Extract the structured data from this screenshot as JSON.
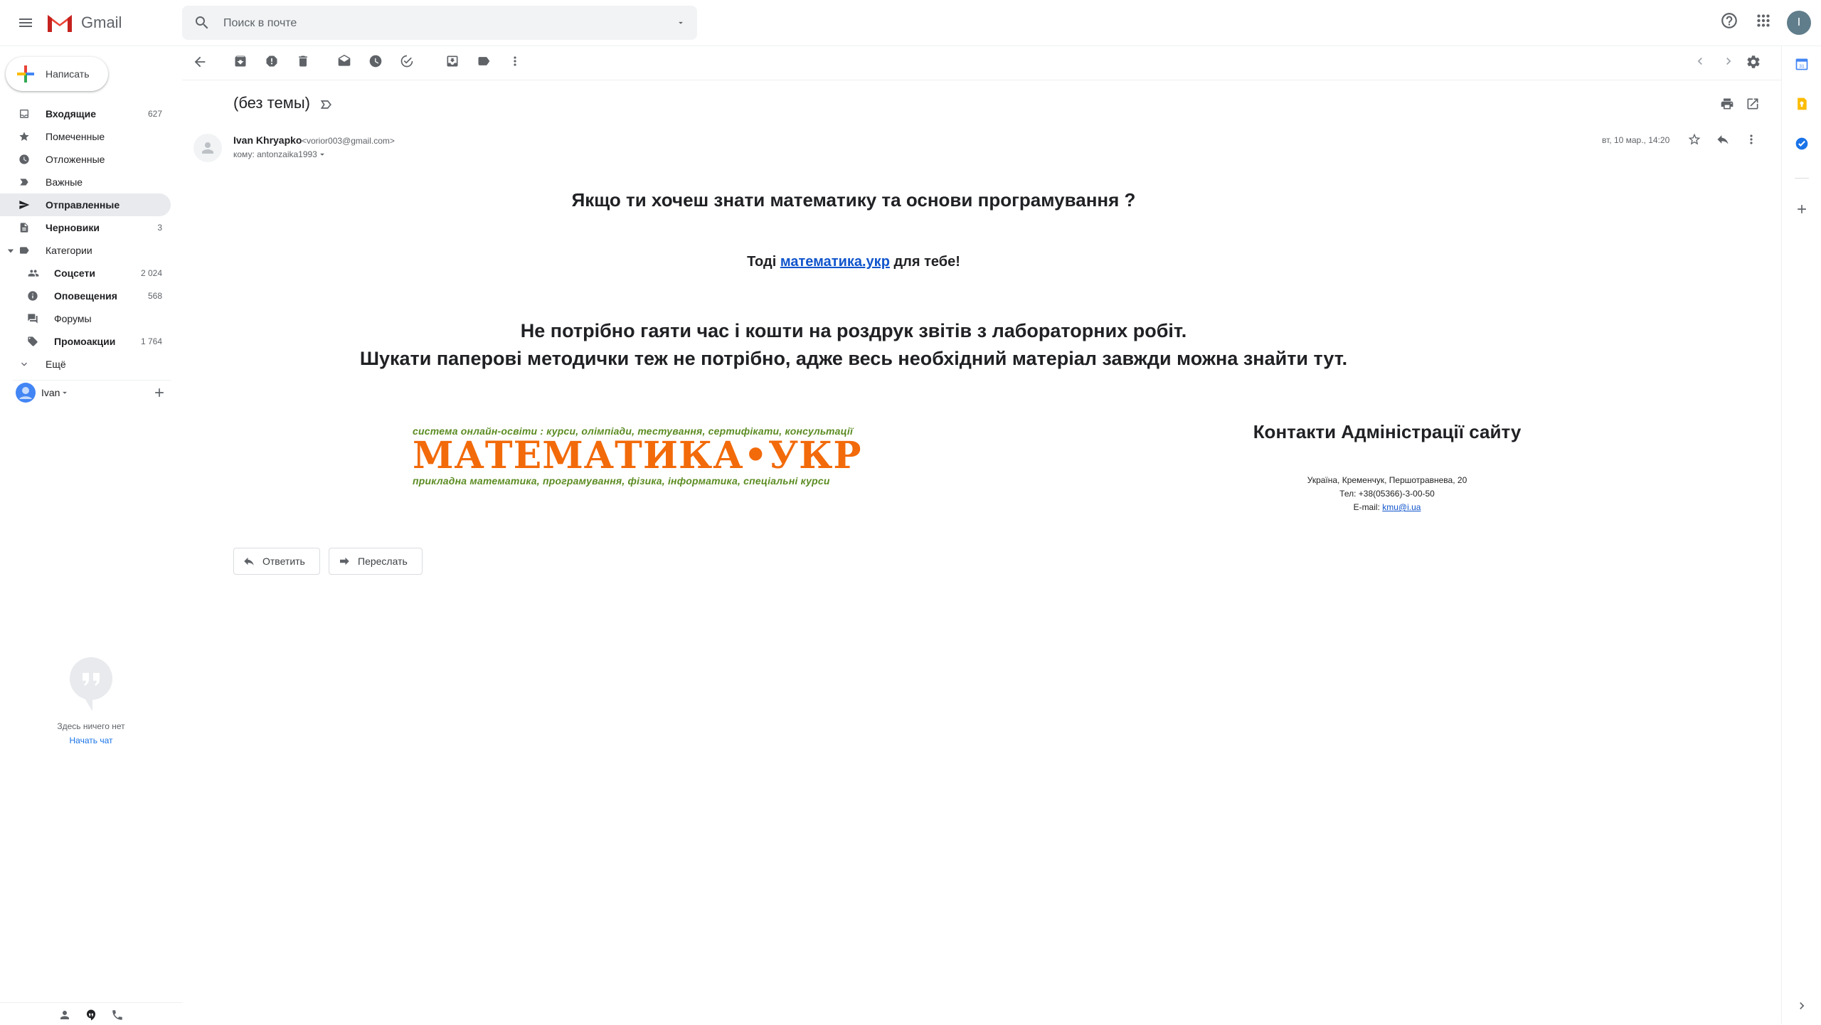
{
  "app": {
    "name": "Gmail"
  },
  "search": {
    "placeholder": "Поиск в почте"
  },
  "account": {
    "initial": "I"
  },
  "compose": {
    "label": "Написать"
  },
  "sidebar": {
    "items": [
      {
        "label": "Входящие",
        "count": "627"
      },
      {
        "label": "Помеченные",
        "count": ""
      },
      {
        "label": "Отложенные",
        "count": ""
      },
      {
        "label": "Важные",
        "count": ""
      },
      {
        "label": "Отправленные",
        "count": ""
      },
      {
        "label": "Черновики",
        "count": "3"
      },
      {
        "label": "Категории",
        "count": ""
      },
      {
        "label": "Соцсети",
        "count": "2 024"
      },
      {
        "label": "Оповещения",
        "count": "568"
      },
      {
        "label": "Форумы",
        "count": ""
      },
      {
        "label": "Промоакции",
        "count": "1 764"
      },
      {
        "label": "Ещё",
        "count": ""
      }
    ],
    "hangouts_user": "Ivan",
    "chat_empty": "Здесь ничего нет",
    "chat_start": "Начать чат"
  },
  "message": {
    "subject": "(без темы)",
    "sender_name": "Ivan Khryapko",
    "sender_email": "<vorior003@gmail.com>",
    "recipient": "кому: antonzaika1993",
    "date": "вт, 10 мар., 14:20",
    "body": {
      "line1": "Якщо ти хочеш знати математику та основи програмування ?",
      "line2_pre": "Тоді ",
      "line2_link": "математика.укр",
      "line2_post": " для тебе!",
      "line3": "Не потрібно гаяти час і кошти на роздрук звітів з лабораторних робіт.",
      "line4": "Шукати паперові методички теж не потрібно, адже весь необхідний матеріал завжди можна знайти тут."
    },
    "logo": {
      "top_text": "система онлайн-освіти : курси, олімпіади, тестування, сертифікати, консультації",
      "main_text": "МАТЕМАТИКА•УКР",
      "bottom_text": "прикладна математика, програмування, фізика, інформатика, спеціальні курси"
    },
    "contacts": {
      "title": "Контакти Адміністрації сайту",
      "address": "Україна, Кременчук, Першотравнева, 20",
      "phone": "Тел: +38(05366)-3-00-50",
      "email_label": "E-mail: ",
      "email": "kmu@i.ua"
    }
  },
  "actions": {
    "reply": "Ответить",
    "forward": "Переслать"
  },
  "colors": {
    "accent": "#1a73e8",
    "logo_orange": "#f26a0a",
    "logo_green": "#5b8c22",
    "active_nav": "#e8eaed"
  }
}
